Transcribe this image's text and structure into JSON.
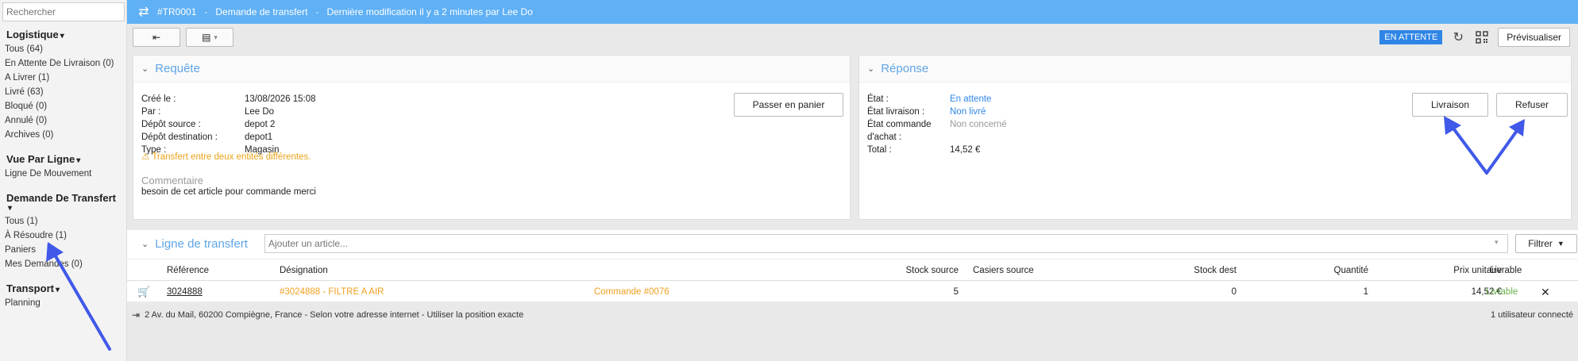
{
  "sidebar": {
    "search_placeholder": "Rechercher",
    "sections": [
      {
        "title": "Logistique",
        "items": [
          "Tous (64)",
          "En Attente De Livraison (0)",
          "A Livrer (1)",
          "Livré (63)",
          "Bloqué (0)",
          "Annulé (0)",
          "Archives (0)"
        ]
      },
      {
        "title": "Vue Par Ligne",
        "items": [
          "Ligne De Mouvement"
        ]
      },
      {
        "title": "Demande De Transfert",
        "items": [
          "Tous (1)",
          "À Résoudre (1)",
          "Paniers",
          "Mes Demandes (0)"
        ]
      },
      {
        "title": "Transport",
        "items": [
          "Planning"
        ]
      }
    ]
  },
  "header": {
    "id": "#TR0001",
    "title": "Demande de transfert",
    "modified": "Dernière modification il y a 2 minutes par Lee Do"
  },
  "toolbar": {
    "status_badge": "EN ATTENTE",
    "preview_label": "Prévisualiser"
  },
  "request": {
    "title": "Requête",
    "fields": [
      {
        "label": "Créé le :",
        "value": "13/08/2026 15:08"
      },
      {
        "label": "Par :",
        "value": "Lee Do"
      },
      {
        "label": "Dépôt source :",
        "value": "depot 2"
      },
      {
        "label": "Dépôt destination :",
        "value": "depot1"
      },
      {
        "label": "Type :",
        "value": "Magasin"
      }
    ],
    "cart_button": "Passer en panier",
    "warning": "Transfert entre deux entités différentes.",
    "comment_title": "Commentaire",
    "comment": "besoin de cet article pour commande merci"
  },
  "response": {
    "title": "Réponse",
    "fields": [
      {
        "label": "État :",
        "value": "En attente"
      },
      {
        "label": "État livraison :",
        "value": "Non livré"
      },
      {
        "label": "État commande",
        "value": "Non concerné"
      },
      {
        "label": "d'achat :",
        "value": ""
      },
      {
        "label": "Total :",
        "value": "14,52 €"
      }
    ],
    "delivery_button": "Livraison",
    "refuse_button": "Refuser"
  },
  "lines": {
    "title": "Ligne de transfert",
    "add_placeholder": "Ajouter un article...",
    "filter_label": "Filtrer",
    "headers": [
      "Référence",
      "Désignation",
      "Stock source",
      "Casiers source",
      "Stock dest",
      "Quantité",
      "Prix unitaire",
      "Livrable"
    ],
    "row": {
      "reference": "3024888",
      "designation": "#3024888 - FILTRE A AIR",
      "order": "Commande #0076",
      "stock_source": "5",
      "casiers_source": "",
      "stock_dest": "0",
      "quantity": "1",
      "unit_price": "14,52 €",
      "deliverable": "Livrable"
    }
  },
  "footer": {
    "location": "2 Av. du Mail, 60200 Compiègne, France - Selon votre adresse internet - Utiliser la position exacte",
    "users": "1 utilisateur connecté"
  }
}
